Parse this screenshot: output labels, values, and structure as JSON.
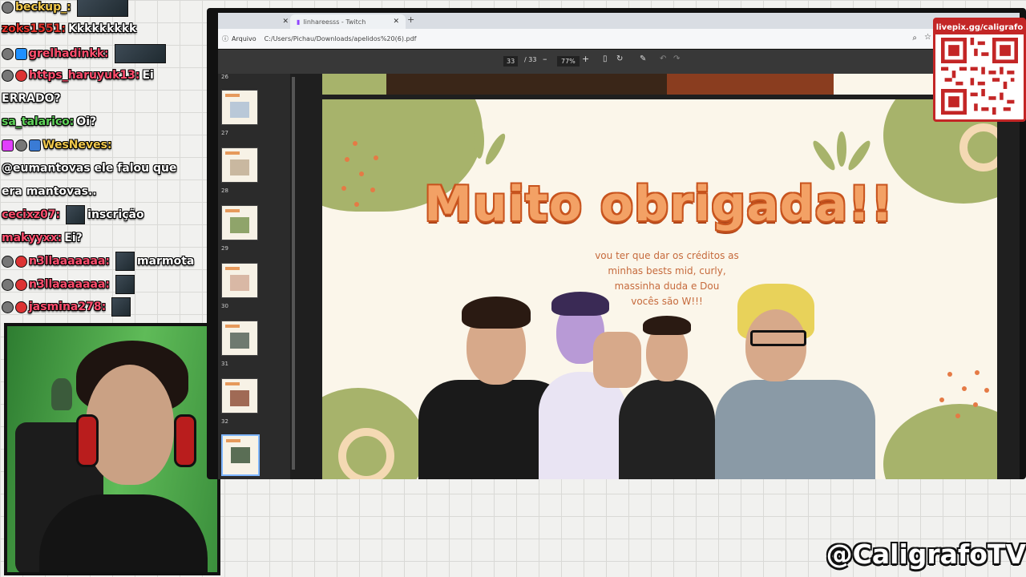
{
  "chat": {
    "messages": [
      {
        "user": "beckup_:",
        "user_color": "#f2c94c",
        "text": "",
        "emote": "wide"
      },
      {
        "user": "zoks1551:",
        "user_color": "#e4322b",
        "text": "Kkkkkkkkk",
        "emote": ""
      },
      {
        "user": "grelhadinkk:",
        "user_color": "#ff4d6d",
        "text": "",
        "emote": "wide"
      },
      {
        "user": "https_haruyuk13:",
        "user_color": "#ff4d6d",
        "text": "Ei",
        "emote": ""
      },
      {
        "user": "",
        "user_color": "#ffffff",
        "text": "ERRADO?",
        "emote": ""
      },
      {
        "user": "sa_talarico:",
        "user_color": "#5fd35a",
        "text": "Oi?",
        "emote": ""
      },
      {
        "user": "WesNeves:",
        "user_color": "#f2c94c",
        "text": "",
        "emote": ""
      },
      {
        "user": "",
        "user_color": "#ffffff",
        "text": "@eumantovas ele falou que",
        "emote": ""
      },
      {
        "user": "",
        "user_color": "#ffffff",
        "text": "era mantovas..",
        "emote": ""
      },
      {
        "user": "cecixz07:",
        "user_color": "#ff4d6d",
        "text": "inscrição",
        "emote": "small"
      },
      {
        "user": "makyyxx:",
        "user_color": "#ff4d6d",
        "text": "Ei?",
        "emote": ""
      },
      {
        "user": "n3llaaaaaaa:",
        "user_color": "#ff4d6d",
        "text": "marmota",
        "emote": "small"
      },
      {
        "user": "n3llaaaaaaa:",
        "user_color": "#ff4d6d",
        "text": "",
        "emote": "small"
      },
      {
        "user": "jasmina278:",
        "user_color": "#ff4d6d",
        "text": "",
        "emote": "small"
      }
    ]
  },
  "browser": {
    "tab_title": "linhareesss - Twitch",
    "address_label": "Arquivo",
    "url": "C:/Users/Pichau/Downloads/apelidos%20(6).pdf",
    "pdf_toolbar": {
      "current_page": "33",
      "total_pages": "/ 33",
      "zoom": "77%",
      "zoom_out": "–",
      "zoom_in": "+"
    },
    "thumbnails": {
      "page_numbers": [
        "26",
        "27",
        "28",
        "29",
        "30",
        "31",
        "32"
      ],
      "active_page": "33"
    }
  },
  "slide": {
    "title": "Muito obrigada!!",
    "credits": [
      "vou ter que dar os créditos as",
      "minhas bests mid, curly,",
      "massinha duda e Dou",
      "vocês são W!!!"
    ]
  },
  "overlay": {
    "donation_label": "livepix.gg/caligrafo",
    "handle": "@CaligrafoTV"
  },
  "colors": {
    "slide_bg": "#fbf6ea",
    "slide_green": "#a7b36b",
    "slide_orange": "#f3a165",
    "webcam_green": "#2e7d31",
    "qr_red": "#c32626"
  }
}
